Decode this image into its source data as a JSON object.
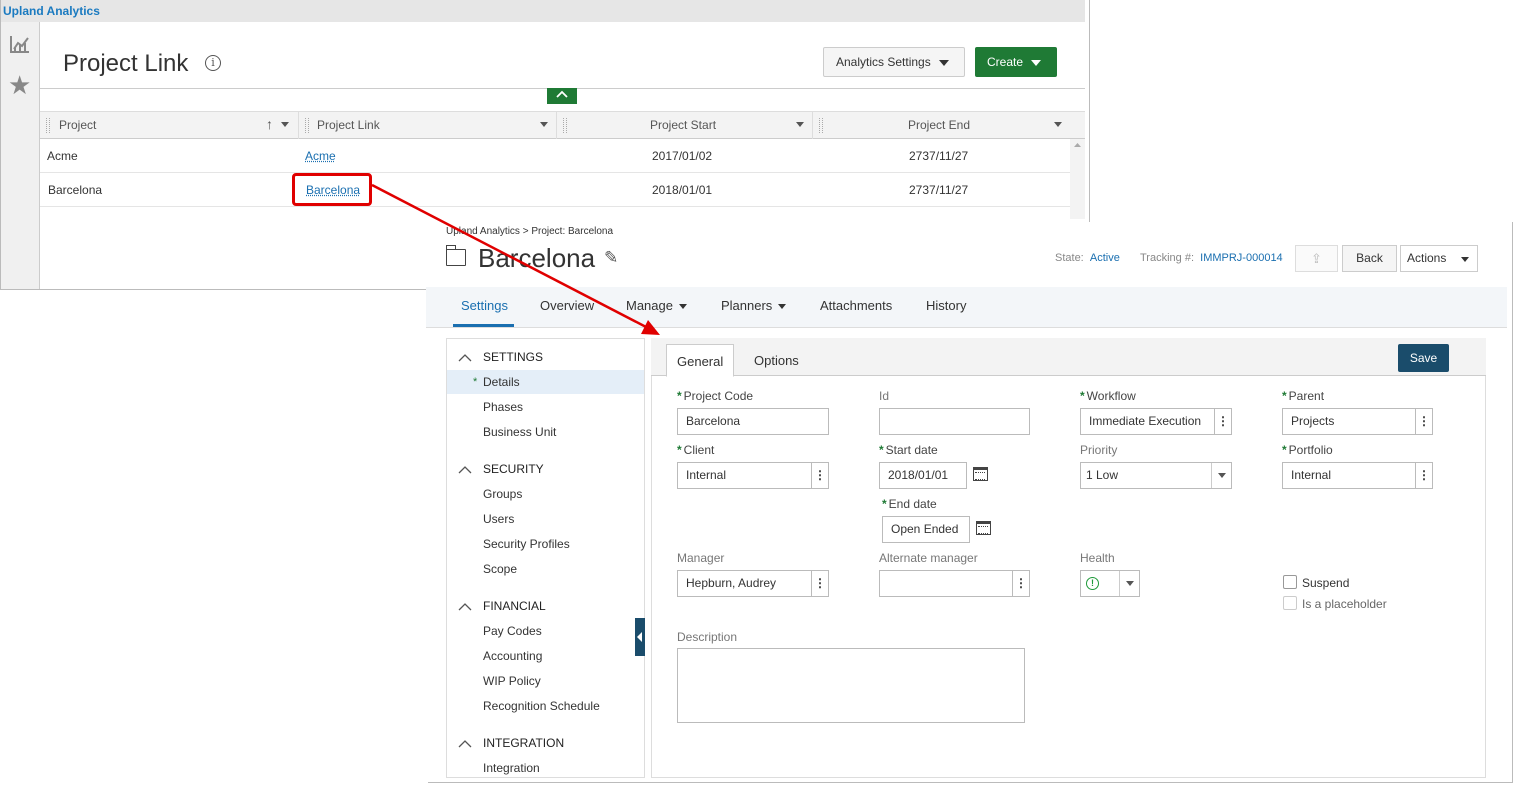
{
  "analytics": {
    "app_name": "Upland Analytics",
    "title": "Project Link",
    "settings_button": "Analytics Settings",
    "create_button": "Create",
    "columns": [
      "Project",
      "Project Link",
      "Project Start",
      "Project End"
    ],
    "rows": [
      {
        "project": "Acme",
        "link": "Acme",
        "start": "2017/01/02",
        "end": "2737/11/27"
      },
      {
        "project": "Barcelona",
        "link": "Barcelona",
        "start": "2018/01/01",
        "end": "2737/11/27"
      }
    ]
  },
  "project": {
    "breadcrumb": "Upland Analytics > Project: Barcelona",
    "title": "Barcelona",
    "state_label": "State:",
    "state_value": "Active",
    "tracking_label": "Tracking #:",
    "tracking_value": "IMMPRJ-000014",
    "back_button": "Back",
    "actions_button": "Actions",
    "tabs": [
      "Settings",
      "Overview",
      "Manage",
      "Planners",
      "Attachments",
      "History"
    ],
    "nav": {
      "sections": [
        {
          "title": "SETTINGS",
          "items": [
            "Details",
            "Phases",
            "Business Unit"
          ]
        },
        {
          "title": "SECURITY",
          "items": [
            "Groups",
            "Users",
            "Security Profiles",
            "Scope"
          ]
        },
        {
          "title": "FINANCIAL",
          "items": [
            "Pay Codes",
            "Accounting",
            "WIP Policy",
            "Recognition Schedule"
          ]
        },
        {
          "title": "INTEGRATION",
          "items": [
            "Integration"
          ]
        }
      ]
    },
    "form": {
      "tabs": [
        "General",
        "Options"
      ],
      "save_button": "Save",
      "project_code_label": "Project Code",
      "project_code_value": "Barcelona",
      "id_label": "Id",
      "id_value": "",
      "workflow_label": "Workflow",
      "workflow_value": "Immediate Execution",
      "parent_label": "Parent",
      "parent_value": "Projects",
      "client_label": "Client",
      "client_value": "Internal",
      "start_date_label": "Start date",
      "start_date_value": "2018/01/01",
      "priority_label": "Priority",
      "priority_value": "1 Low",
      "portfolio_label": "Portfolio",
      "portfolio_value": "Internal",
      "end_date_label": "End date",
      "end_date_value": "Open Ended",
      "manager_label": "Manager",
      "manager_value": "Hepburn, Audrey",
      "alt_manager_label": "Alternate manager",
      "alt_manager_value": "",
      "health_label": "Health",
      "suspend_label": "Suspend",
      "placeholder_label": "Is a placeholder",
      "description_label": "Description"
    }
  },
  "colors": {
    "brand_blue": "#1a7ac0",
    "green": "#1f7a35",
    "navy": "#1a4c6b",
    "highlight_red": "#e00000"
  }
}
